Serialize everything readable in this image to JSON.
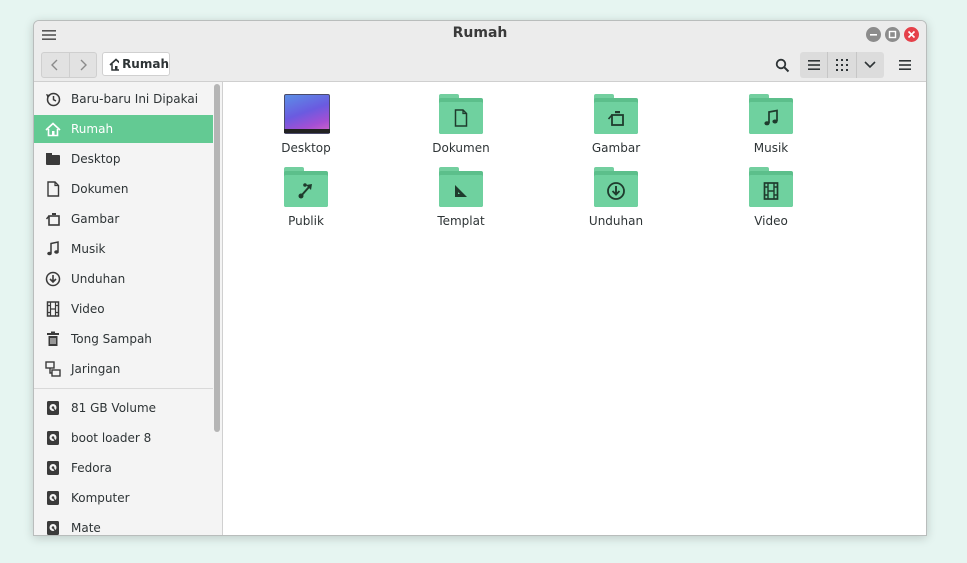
{
  "window": {
    "title": "Rumah"
  },
  "toolbar": {
    "breadcrumb": "Rumah"
  },
  "sidebar": {
    "places": [
      {
        "label": "Baru-baru Ini Dipakai",
        "icon": "recent-icon"
      },
      {
        "label": "Rumah",
        "icon": "home-icon",
        "active": true
      },
      {
        "label": "Desktop",
        "icon": "desktop-folder-icon"
      },
      {
        "label": "Dokumen",
        "icon": "document-icon"
      },
      {
        "label": "Gambar",
        "icon": "picture-icon"
      },
      {
        "label": "Musik",
        "icon": "music-icon"
      },
      {
        "label": "Unduhan",
        "icon": "download-icon"
      },
      {
        "label": "Video",
        "icon": "video-icon"
      },
      {
        "label": "Tong Sampah",
        "icon": "trash-icon"
      },
      {
        "label": "Jaringan",
        "icon": "network-icon"
      }
    ],
    "devices": [
      {
        "label": "81 GB Volume",
        "icon": "drive-icon"
      },
      {
        "label": "boot loader 8",
        "icon": "drive-icon"
      },
      {
        "label": "Fedora",
        "icon": "drive-icon"
      },
      {
        "label": "Komputer",
        "icon": "drive-icon"
      },
      {
        "label": "Mate",
        "icon": "drive-icon"
      }
    ]
  },
  "files": [
    {
      "label": "Desktop",
      "icon": "desktop-wallpaper-icon"
    },
    {
      "label": "Dokumen",
      "icon": "document-icon"
    },
    {
      "label": "Gambar",
      "icon": "picture-icon"
    },
    {
      "label": "Musik",
      "icon": "music-icon"
    },
    {
      "label": "Publik",
      "icon": "share-icon"
    },
    {
      "label": "Templat",
      "icon": "template-icon"
    },
    {
      "label": "Unduhan",
      "icon": "download-icon"
    },
    {
      "label": "Video",
      "icon": "video-icon"
    }
  ],
  "colors": {
    "accent": "#63ca93",
    "folder": "#6fd19f",
    "close": "#e5414a"
  }
}
